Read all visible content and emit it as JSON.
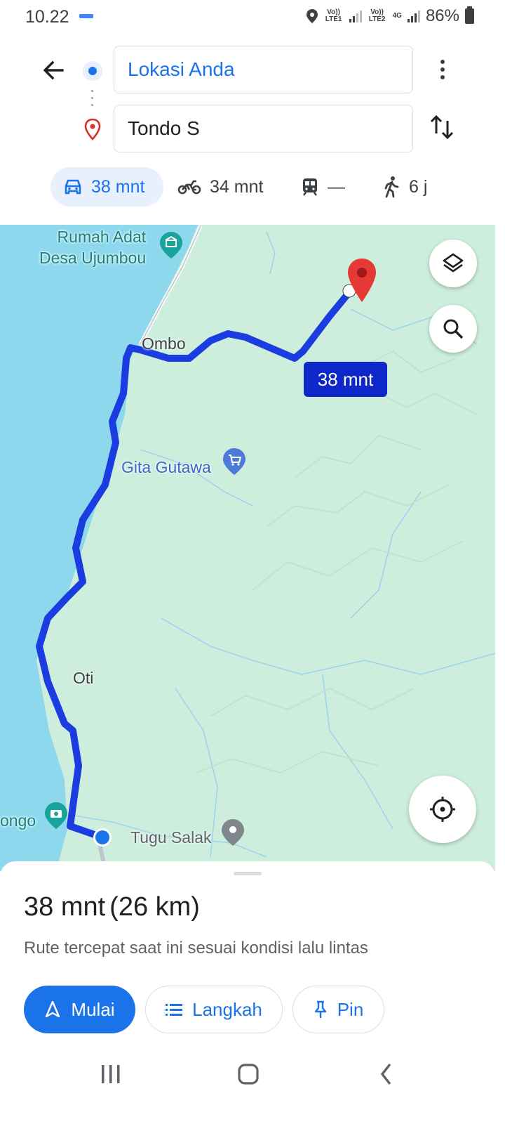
{
  "status_bar": {
    "time": "10.22",
    "sim1_label": "Vo)) LTE1",
    "sim2_label": "Vo)) LTE2",
    "data_label": "4G",
    "battery": "86%"
  },
  "directions": {
    "origin": "Lokasi Anda",
    "destination": "Tondo S"
  },
  "modes": [
    {
      "name": "car",
      "label": "38 mnt",
      "active": true
    },
    {
      "name": "motorcycle",
      "label": "34 mnt",
      "active": false
    },
    {
      "name": "transit",
      "label": "—",
      "active": false
    },
    {
      "name": "walk",
      "label": "6 j",
      "active": false
    }
  ],
  "map": {
    "labels": {
      "poi_rumah_adat": "Rumah Adat\nDesa Ujumbou",
      "ombo": "Ombo",
      "gita_gutawa": "Gita Gutawa",
      "oti": "Oti",
      "tongo": "ongo",
      "tugu_salak": "Tugu Salak"
    },
    "route_duration": "38 mnt",
    "colors": {
      "water": "#8ed8ee",
      "land": "#cdeedd",
      "route": "#1a3ce0",
      "destination_pin": "#e53935"
    }
  },
  "sheet": {
    "duration": "38 mnt",
    "distance": "(26 km)",
    "description": "Rute tercepat saat ini sesuai kondisi lalu lintas",
    "start_label": "Mulai",
    "steps_label": "Langkah",
    "pin_label": "Pin"
  },
  "icons": [
    "back-arrow-icon",
    "more-vert-icon",
    "swap-icon",
    "car-icon",
    "motorcycle-icon",
    "train-icon",
    "walk-icon",
    "layers-icon",
    "search-icon",
    "my-location-icon",
    "navigation-icon",
    "list-icon",
    "pin-icon"
  ]
}
